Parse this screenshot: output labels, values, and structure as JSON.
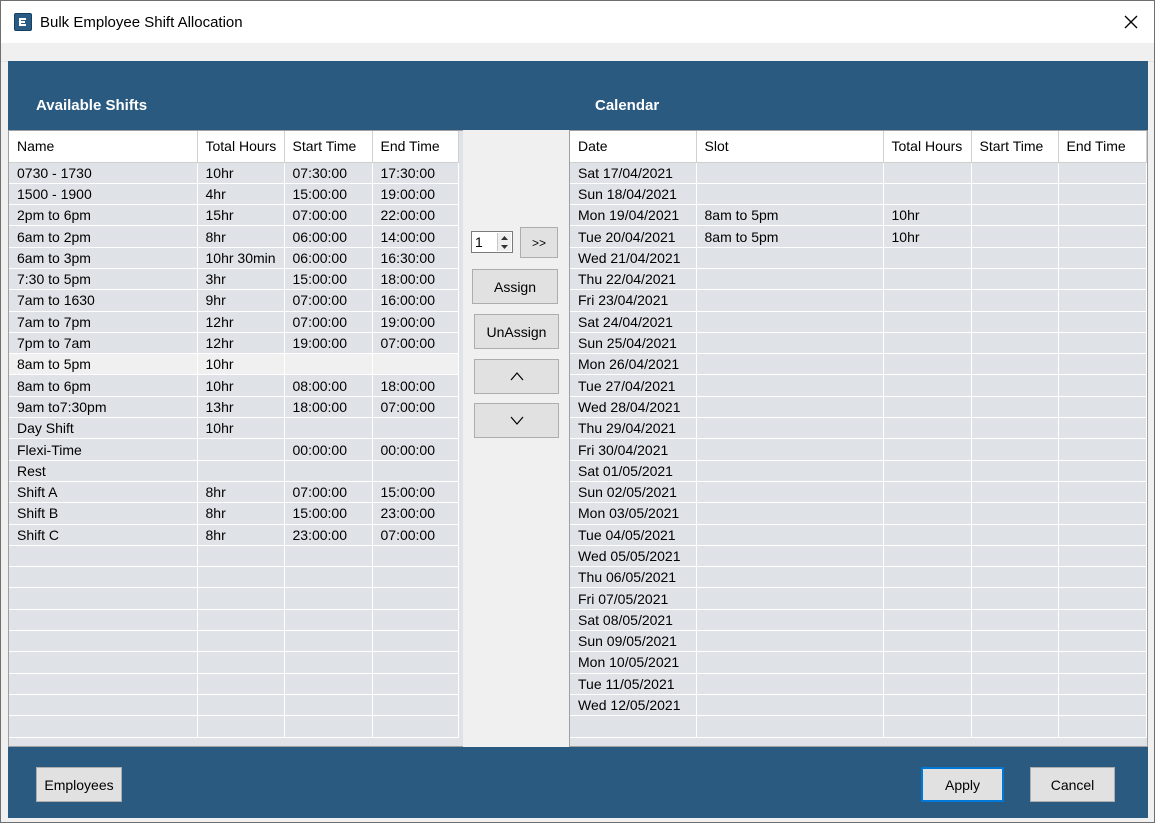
{
  "window": {
    "title": "Bulk Employee Shift Allocation"
  },
  "icons": {
    "app": "app-logo-icon",
    "close": "close-icon",
    "up": "chevron-up-icon",
    "down": "chevron-down-icon"
  },
  "colors": {
    "band": "#2b5a80",
    "grid_bg": "#dfe2e7",
    "selected_row": "#f0f0f0"
  },
  "available_shifts": {
    "label": "Available Shifts",
    "columns": [
      "Name",
      "Total Hours",
      "Start Time",
      "End Time"
    ],
    "selected_index": 9,
    "rows": [
      [
        "0730 - 1730",
        "10hr",
        "07:30:00",
        "17:30:00"
      ],
      [
        "1500 - 1900",
        "4hr",
        "15:00:00",
        "19:00:00"
      ],
      [
        "2pm to 6pm",
        "15hr",
        "07:00:00",
        "22:00:00"
      ],
      [
        "6am to 2pm",
        "8hr",
        "06:00:00",
        "14:00:00"
      ],
      [
        "6am to 3pm",
        "10hr 30min",
        "06:00:00",
        "16:30:00"
      ],
      [
        "7:30 to 5pm",
        "3hr",
        "15:00:00",
        "18:00:00"
      ],
      [
        "7am to 1630",
        "9hr",
        "07:00:00",
        "16:00:00"
      ],
      [
        "7am to 7pm",
        "12hr",
        "07:00:00",
        "19:00:00"
      ],
      [
        "7pm to 7am",
        "12hr",
        "19:00:00",
        "07:00:00"
      ],
      [
        "8am to 5pm",
        "10hr",
        "",
        ""
      ],
      [
        "8am to 6pm",
        "10hr",
        "08:00:00",
        "18:00:00"
      ],
      [
        "9am to7:30pm",
        "13hr",
        "18:00:00",
        "07:00:00"
      ],
      [
        "Day Shift",
        "10hr",
        "",
        ""
      ],
      [
        "Flexi-Time",
        "",
        "00:00:00",
        "00:00:00"
      ],
      [
        "Rest",
        "",
        "",
        ""
      ],
      [
        "Shift A",
        "8hr",
        "07:00:00",
        "15:00:00"
      ],
      [
        "Shift B",
        "8hr",
        "15:00:00",
        "23:00:00"
      ],
      [
        "Shift C",
        "8hr",
        "23:00:00",
        "07:00:00"
      ]
    ]
  },
  "calendar": {
    "label": "Calendar",
    "columns": [
      "Date",
      "Slot",
      "Total Hours",
      "Start Time",
      "End Time"
    ],
    "rows": [
      [
        "Sat 17/04/2021",
        "",
        "",
        "",
        ""
      ],
      [
        "Sun 18/04/2021",
        "",
        "",
        "",
        ""
      ],
      [
        "Mon 19/04/2021",
        "8am to 5pm",
        "10hr",
        "",
        ""
      ],
      [
        "Tue 20/04/2021",
        "8am to 5pm",
        "10hr",
        "",
        ""
      ],
      [
        "Wed 21/04/2021",
        "",
        "",
        "",
        ""
      ],
      [
        "Thu 22/04/2021",
        "",
        "",
        "",
        ""
      ],
      [
        "Fri 23/04/2021",
        "",
        "",
        "",
        ""
      ],
      [
        "Sat 24/04/2021",
        "",
        "",
        "",
        ""
      ],
      [
        "Sun 25/04/2021",
        "",
        "",
        "",
        ""
      ],
      [
        "Mon 26/04/2021",
        "",
        "",
        "",
        ""
      ],
      [
        "Tue 27/04/2021",
        "",
        "",
        "",
        ""
      ],
      [
        "Wed 28/04/2021",
        "",
        "",
        "",
        ""
      ],
      [
        "Thu 29/04/2021",
        "",
        "",
        "",
        ""
      ],
      [
        "Fri 30/04/2021",
        "",
        "",
        "",
        ""
      ],
      [
        "Sat 01/05/2021",
        "",
        "",
        "",
        ""
      ],
      [
        "Sun 02/05/2021",
        "",
        "",
        "",
        ""
      ],
      [
        "Mon 03/05/2021",
        "",
        "",
        "",
        ""
      ],
      [
        "Tue 04/05/2021",
        "",
        "",
        "",
        ""
      ],
      [
        "Wed 05/05/2021",
        "",
        "",
        "",
        ""
      ],
      [
        "Thu 06/05/2021",
        "",
        "",
        "",
        ""
      ],
      [
        "Fri 07/05/2021",
        "",
        "",
        "",
        ""
      ],
      [
        "Sat 08/05/2021",
        "",
        "",
        "",
        ""
      ],
      [
        "Sun 09/05/2021",
        "",
        "",
        "",
        ""
      ],
      [
        "Mon 10/05/2021",
        "",
        "",
        "",
        ""
      ],
      [
        "Tue 11/05/2021",
        "",
        "",
        "",
        ""
      ],
      [
        "Wed 12/05/2021",
        "",
        "",
        "",
        ""
      ]
    ]
  },
  "controls": {
    "count_value": "1",
    "move_label": ">>",
    "assign_label": "Assign",
    "unassign_label": "UnAssign"
  },
  "footer": {
    "employees_label": "Employees",
    "apply_label": "Apply",
    "cancel_label": "Cancel"
  }
}
